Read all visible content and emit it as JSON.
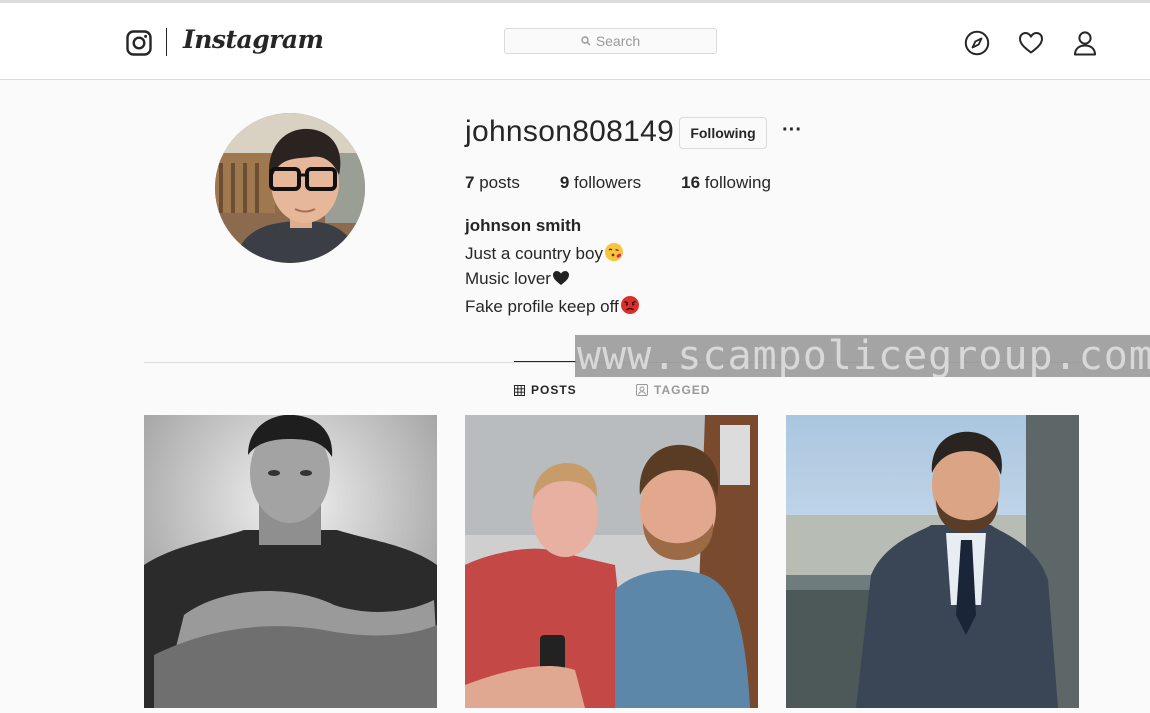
{
  "header": {
    "brand": "Instagram",
    "search_placeholder": "Search",
    "icons": [
      "instagram-logo-icon",
      "compass-icon",
      "heart-icon",
      "user-icon"
    ]
  },
  "profile": {
    "username": "johnson808149",
    "follow_label": "Following",
    "more_label": "···",
    "stats": {
      "posts_count": "7",
      "posts_label": "posts",
      "followers_count": "9",
      "followers_label": "followers",
      "following_count": "16",
      "following_label": "following"
    },
    "full_name": "johnson smith",
    "bio": [
      "Just a country boy",
      "Music lover",
      "Fake profile keep off"
    ],
    "bio_emojis": [
      "face-blowing-kiss-icon",
      "black-heart-icon",
      "angry-face-icon"
    ]
  },
  "watermark": "www.scampolicegroup.com",
  "tabs": [
    {
      "label": "POSTS",
      "icon": "grid-icon",
      "active": true
    },
    {
      "label": "TAGGED",
      "icon": "tagged-icon",
      "active": false
    }
  ],
  "posts": [
    {
      "photo": "black-and-white-portrait"
    },
    {
      "photo": "selfie-two-men"
    },
    {
      "photo": "man-in-suit-city"
    }
  ],
  "colors": {
    "background": "#fafafa",
    "text": "#262626",
    "muted": "#999999",
    "border": "#dbdbdb"
  }
}
